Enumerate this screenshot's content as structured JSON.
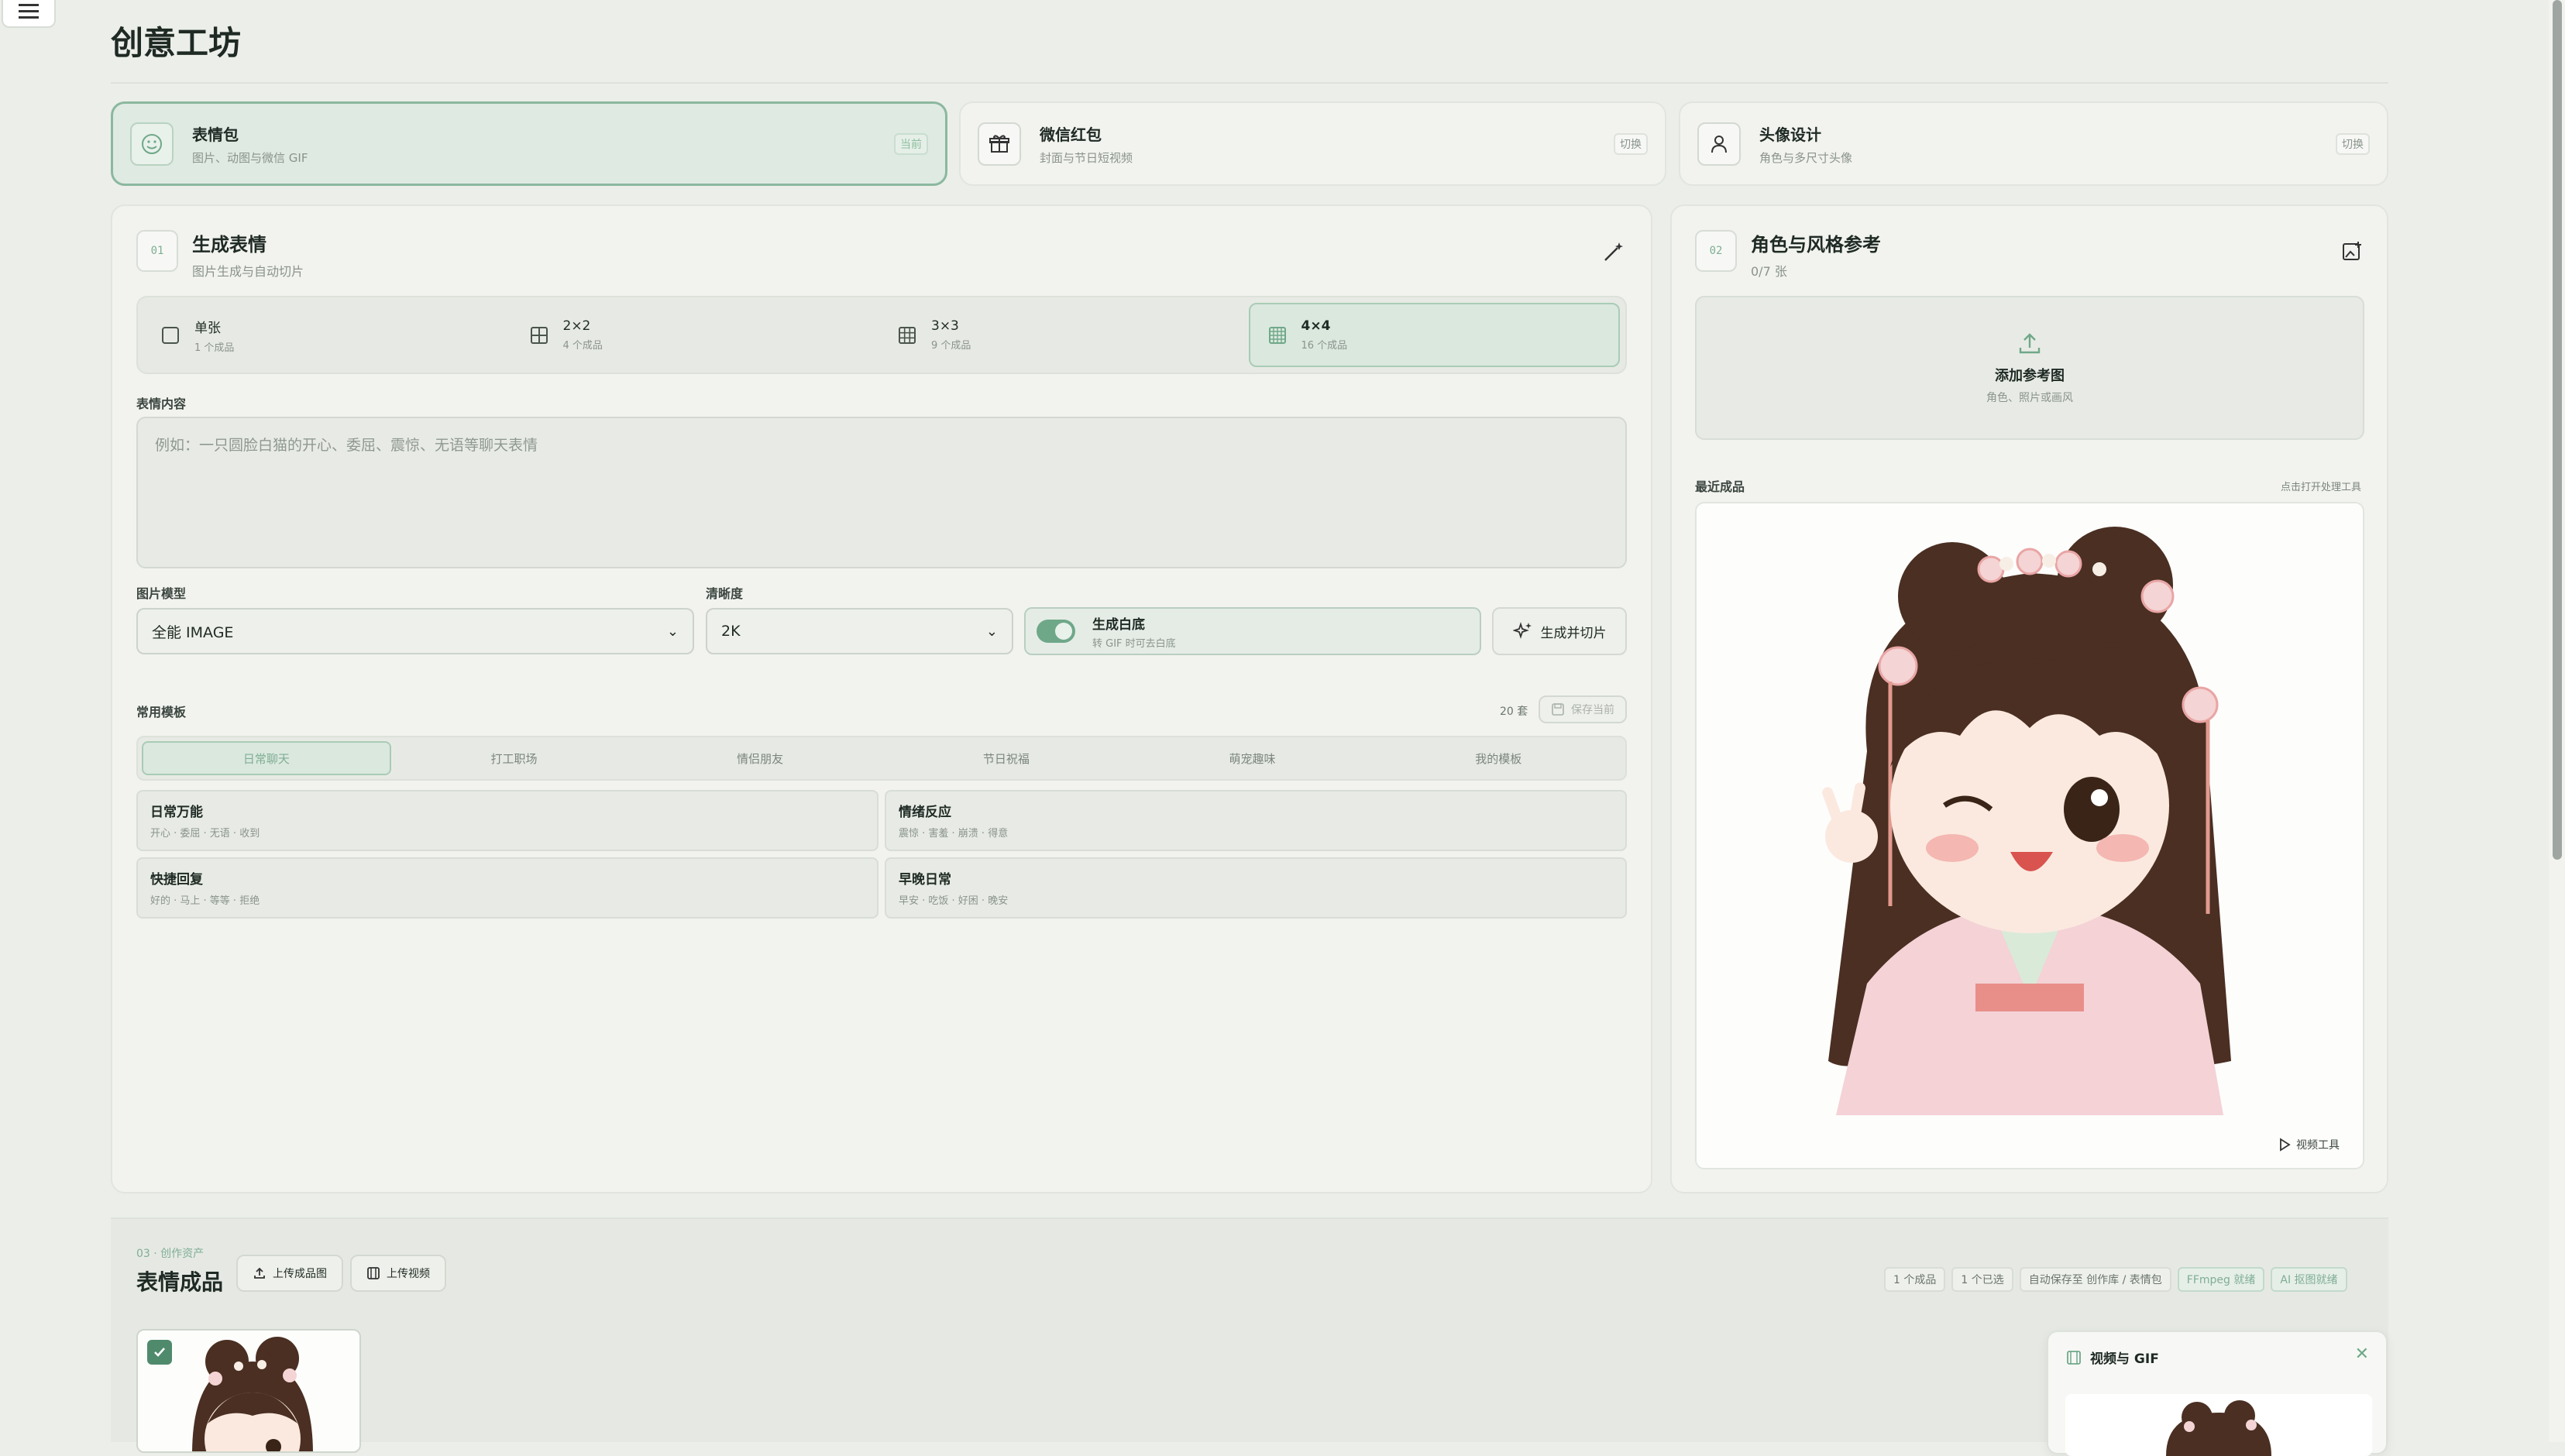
{
  "page": {
    "title": "创意工坊"
  },
  "types": [
    {
      "name": "表情包",
      "desc": "图片、动图与微信 GIF",
      "badge": "当前"
    },
    {
      "name": "微信红包",
      "desc": "封面与节日短视频",
      "badge": "切换"
    },
    {
      "name": "头像设计",
      "desc": "角色与多尺寸头像",
      "badge": "切换"
    }
  ],
  "generate": {
    "step": "01",
    "title": "生成表情",
    "subtitle": "图片生成与自动切片",
    "grid_options": [
      {
        "name": "单张",
        "sub": "1 个成品"
      },
      {
        "name": "2×2",
        "sub": "4 个成品"
      },
      {
        "name": "3×3",
        "sub": "9 个成品"
      },
      {
        "name": "4×4",
        "sub": "16 个成品"
      }
    ],
    "content_label": "表情内容",
    "content_placeholder": "例如：一只圆脸白猫的开心、委屈、震惊、无语等聊天表情",
    "model_label": "图片模型",
    "model_value": "全能 IMAGE",
    "clarity_label": "清晰度",
    "clarity_value": "2K",
    "toggle_title": "生成白底",
    "toggle_sub": "转 GIF 时可去白底",
    "generate_btn": "生成并切片",
    "templates_label": "常用模板",
    "templates_count": "20 套",
    "save_btn": "保存当前",
    "tabs": [
      "日常聊天",
      "打工职场",
      "情侣朋友",
      "节日祝福",
      "萌宠趣味",
      "我的模板"
    ],
    "templates": [
      {
        "name": "日常万能",
        "sub": "开心 · 委屈 · 无语 · 收到"
      },
      {
        "name": "情绪反应",
        "sub": "震惊 · 害羞 · 崩溃 · 得意"
      },
      {
        "name": "快捷回复",
        "sub": "好的 · 马上 · 等等 · 拒绝"
      },
      {
        "name": "早晚日常",
        "sub": "早安 · 吃饭 · 好困 · 晚安"
      }
    ]
  },
  "reference": {
    "step": "02",
    "title": "角色与风格参考",
    "count": "0/7 张",
    "add_title": "添加参考图",
    "add_sub": "角色、照片或画风",
    "recent_label": "最近成品",
    "recent_hint": "点击打开处理工具",
    "video_tool": "视频工具"
  },
  "assets": {
    "eyebrow": "03 · 创作资产",
    "title": "表情成品",
    "upload_image": "上传成品图",
    "upload_video": "上传视频",
    "chips": [
      "1 个成品",
      "1 个已选",
      "自动保存至 创作库 / 表情包",
      "FFmpeg 就绪",
      "AI 抠图就绪"
    ],
    "panel_title": "视频与 GIF"
  },
  "colors": {
    "accent": "#6fa889",
    "background": "#eceee9",
    "card": "#f2f3ef"
  }
}
